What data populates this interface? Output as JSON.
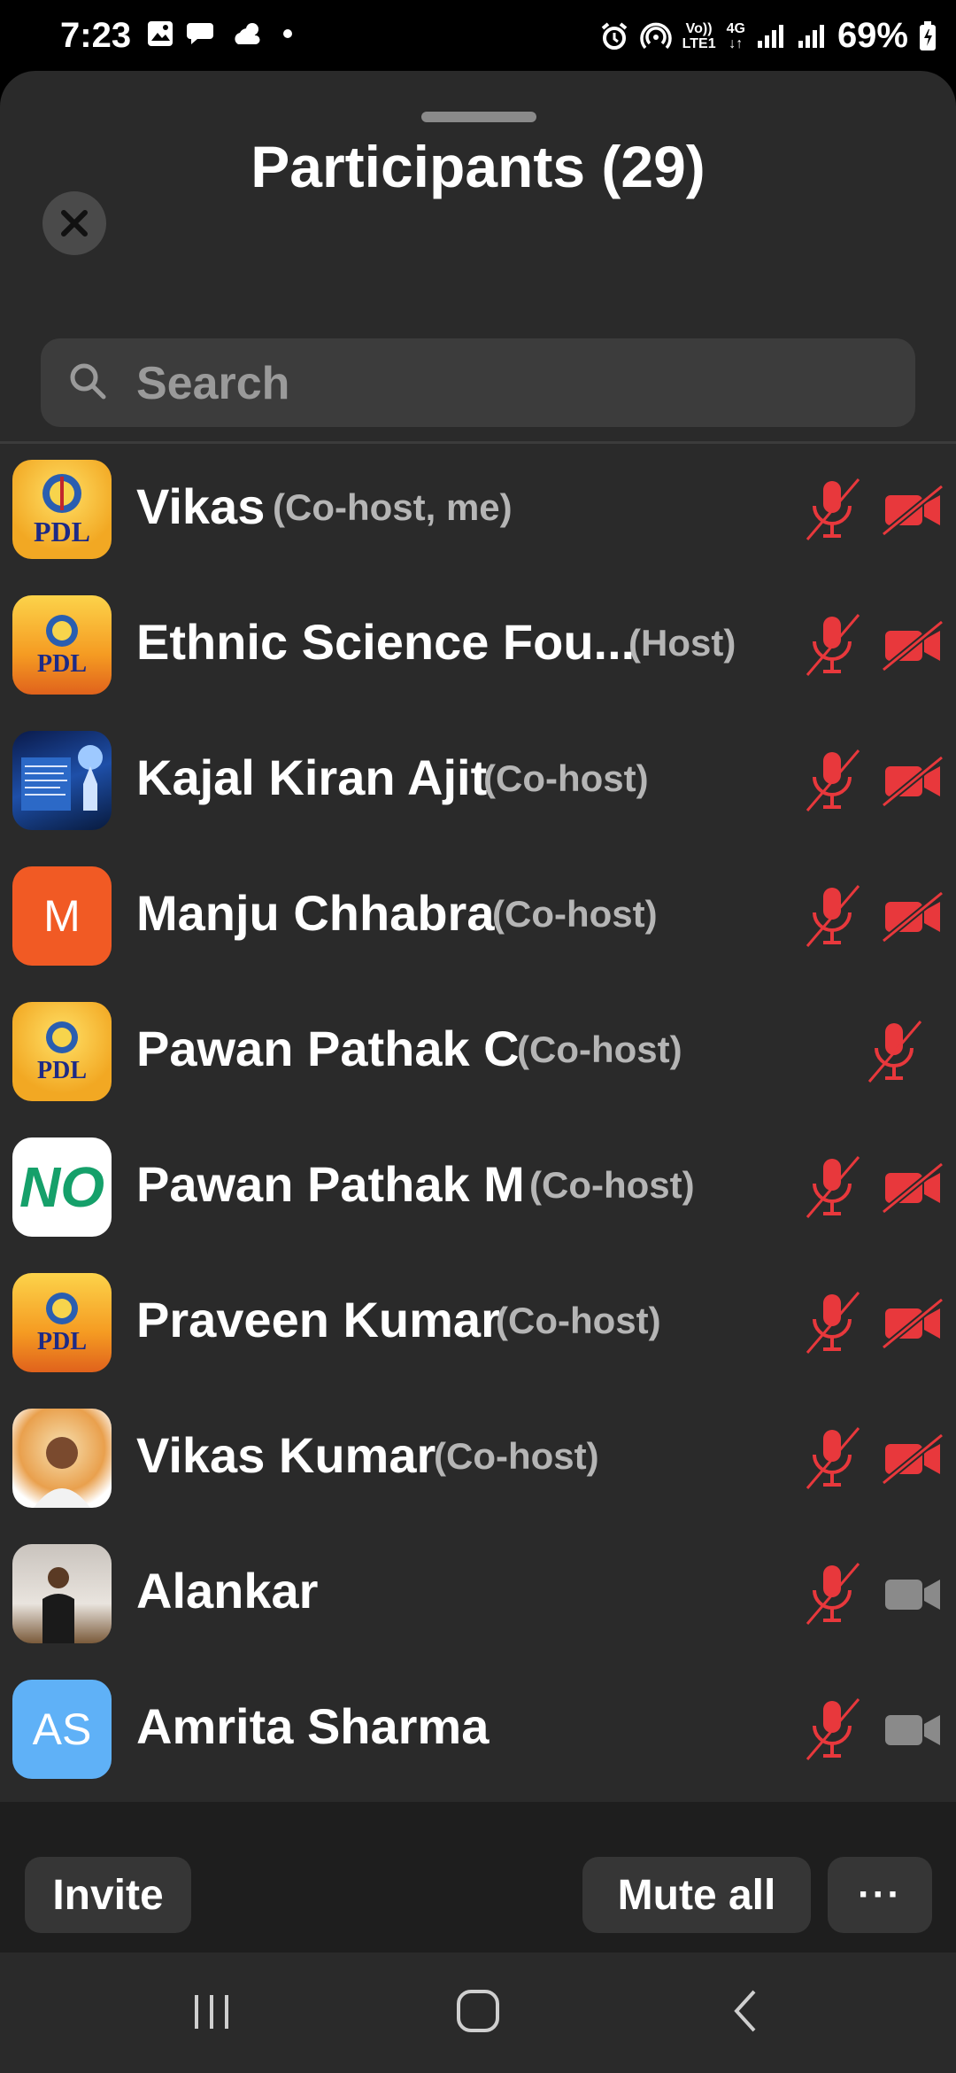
{
  "status_bar": {
    "time": "7:23",
    "network_top": "Vo))",
    "network_bottom": "LTE1",
    "gen_top": "4G",
    "gen_bottom": "↓↑",
    "battery": "69%"
  },
  "sheet": {
    "title": "Participants (29)"
  },
  "search": {
    "placeholder": "Search"
  },
  "participants": [
    {
      "name": "Vikas",
      "role": "(Co-host, me)",
      "avatar": "PDL",
      "mic": "muted",
      "video": "off"
    },
    {
      "name": "Ethnic Science Fou...",
      "role": "(Host)",
      "avatar": "PDL",
      "mic": "muted",
      "video": "off"
    },
    {
      "name": "Kajal Kiran Ajit",
      "role": "(Co-host)",
      "avatar": "poster",
      "mic": "muted",
      "video": "off"
    },
    {
      "name": "Manju Chhabra",
      "role": "(Co-host)",
      "avatar": "M",
      "mic": "muted",
      "video": "off"
    },
    {
      "name": "Pawan Pathak C",
      "role": "(Co-host)",
      "avatar": "PDL",
      "mic": "muted",
      "video": "none"
    },
    {
      "name": "Pawan Pathak M",
      "role": "(Co-host)",
      "avatar": "NO",
      "mic": "muted",
      "video": "off"
    },
    {
      "name": "Praveen Kumar",
      "role": "(Co-host)",
      "avatar": "PDL",
      "mic": "muted",
      "video": "off"
    },
    {
      "name": "Vikas Kumar",
      "role": "(Co-host)",
      "avatar": "photo",
      "mic": "muted",
      "video": "off"
    },
    {
      "name": "Alankar",
      "role": "",
      "avatar": "photo",
      "mic": "muted",
      "video": "available"
    },
    {
      "name": "Amrita Sharma",
      "role": "",
      "avatar": "AS",
      "mic": "muted",
      "video": "available"
    }
  ],
  "footer": {
    "invite": "Invite",
    "mute_all": "Mute all",
    "more": "···"
  },
  "colors": {
    "muted_red": "#e8383c",
    "sheet_bg": "#2a2a2a",
    "manju_avatar": "#f15a24",
    "amrita_avatar": "#5fb1f7"
  }
}
